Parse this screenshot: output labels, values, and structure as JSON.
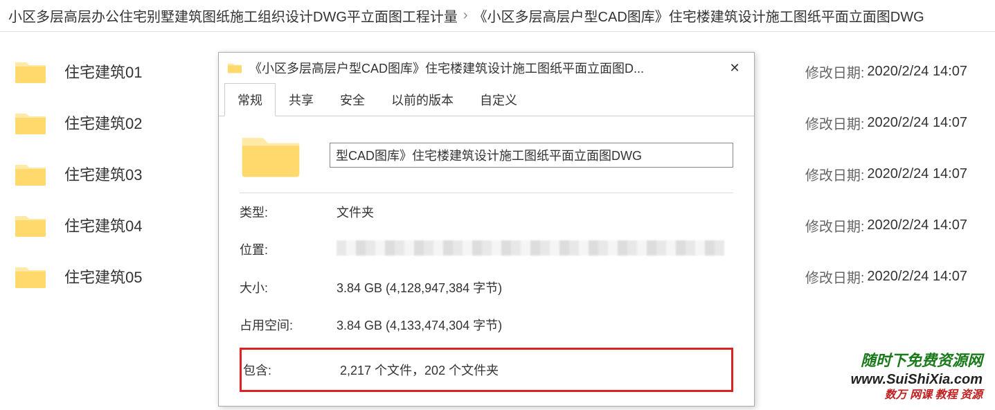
{
  "breadcrumb": {
    "item1": "小区多层高层办公住宅别墅建筑图纸施工组织设计DWG平立面图工程计量",
    "sep": "›",
    "item2": "《小区多层高层户型CAD图库》住宅楼建筑设计施工图纸平面立面图DWG"
  },
  "files": [
    {
      "name": "住宅建筑01",
      "date_label": "修改日期:",
      "date": "2020/2/24 14:07"
    },
    {
      "name": "住宅建筑02",
      "date_label": "修改日期:",
      "date": "2020/2/24 14:07"
    },
    {
      "name": "住宅建筑03",
      "date_label": "修改日期:",
      "date": "2020/2/24 14:07"
    },
    {
      "name": "住宅建筑04",
      "date_label": "修改日期:",
      "date": "2020/2/24 14:07"
    },
    {
      "name": "住宅建筑05",
      "date_label": "修改日期:",
      "date": "2020/2/24 14:07"
    }
  ],
  "dialog": {
    "title": "《小区多层高层户型CAD图库》住宅楼建筑设计施工图纸平面立面图D...",
    "close": "✕",
    "tabs": {
      "general": "常规",
      "share": "共享",
      "security": "安全",
      "previous": "以前的版本",
      "custom": "自定义"
    },
    "folder_name": "型CAD图库》住宅楼建筑设计施工图纸平面立面图DWG",
    "props": {
      "type_label": "类型:",
      "type_value": "文件夹",
      "location_label": "位置:",
      "size_label": "大小:",
      "size_value": "3.84 GB (4,128,947,384 字节)",
      "disk_label": "占用空间:",
      "disk_value": "3.84 GB (4,133,474,304 字节)",
      "contains_label": "包含:",
      "contains_value": "2,217 个文件，202 个文件夹"
    }
  },
  "watermark": {
    "line1": "随时下免费资源网",
    "line2": "www.SuiShiXia.com",
    "line3": "数万 网课 教程 资源"
  }
}
